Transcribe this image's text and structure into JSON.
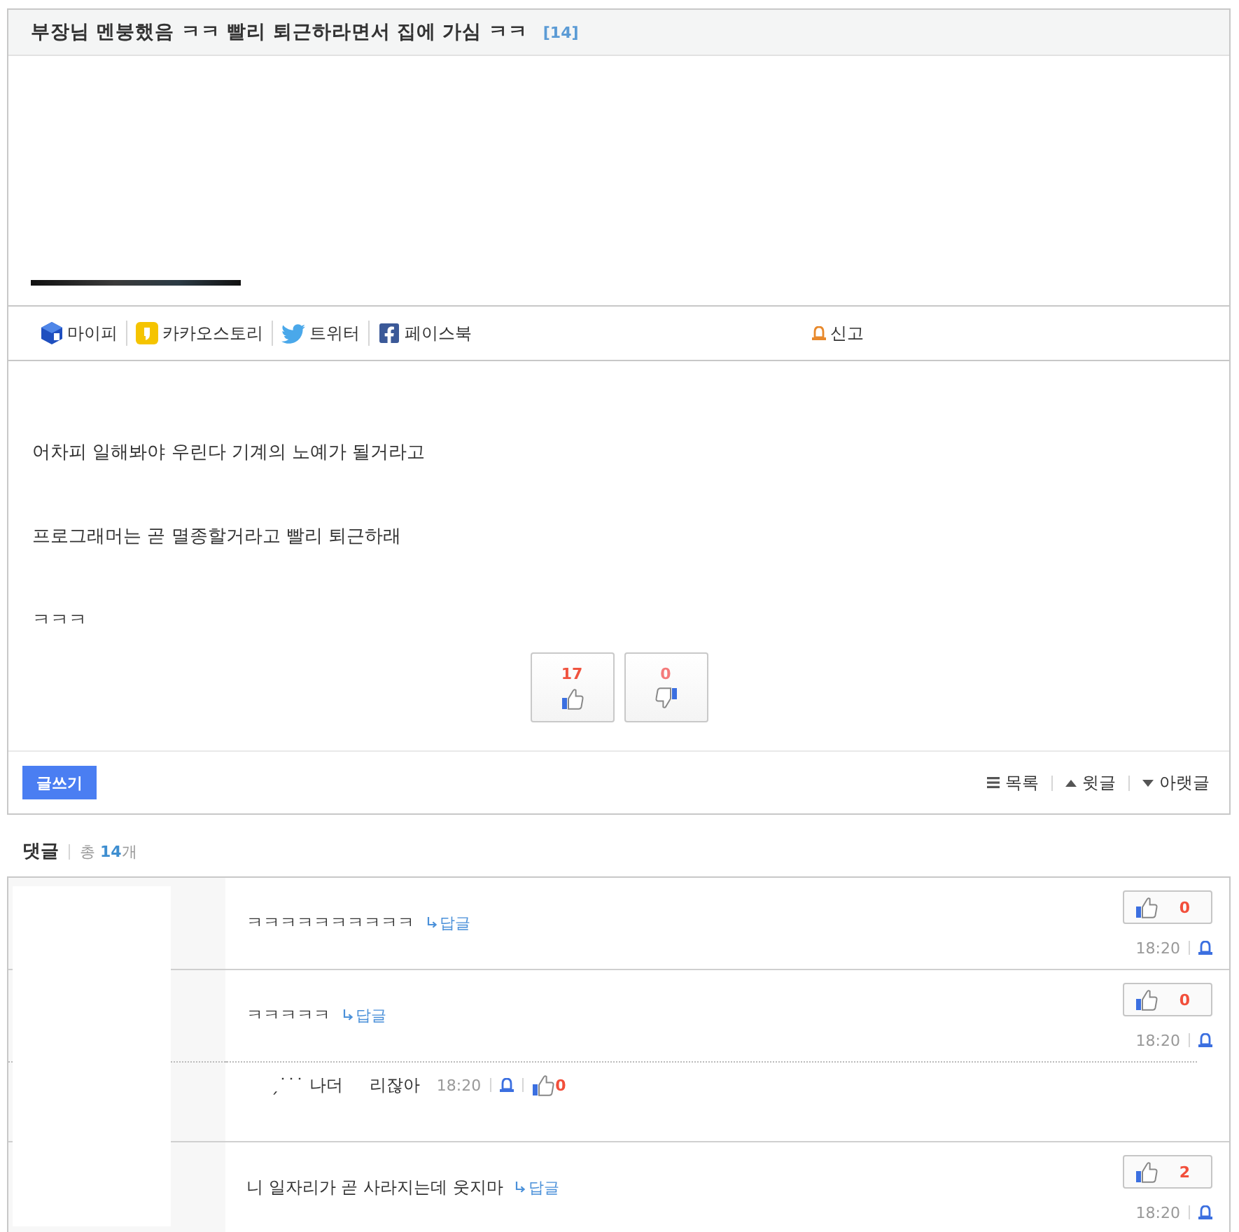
{
  "post": {
    "title": "부장님 멘붕했음 ㅋㅋ 빨리 퇴근하라면서 집에 가심 ㅋㅋ",
    "comment_count": "[14]"
  },
  "share": {
    "items": [
      {
        "kind": "mypeople",
        "label": "마이피"
      },
      {
        "kind": "kakaostory",
        "label": "카카오스토리"
      },
      {
        "kind": "twitter",
        "label": "트위터"
      },
      {
        "kind": "facebook",
        "label": "페이스북"
      }
    ],
    "report": "신고"
  },
  "body": {
    "paragraphs": [
      "어차피 일해봐야 우린다 기계의 노예가 될거라고",
      "프로그래머는 곧 멸종할거라고 빨리 퇴근하래",
      "ㅋㅋㅋ"
    ]
  },
  "votes": [
    {
      "kind": "up",
      "count": "17"
    },
    {
      "kind": "down",
      "count": "0"
    }
  ],
  "footer": {
    "write_button": "글쓰기",
    "nav": [
      {
        "kind": "list",
        "label": "목록"
      },
      {
        "kind": "prev",
        "label": "윗글"
      },
      {
        "kind": "next",
        "label": "아랫글"
      }
    ]
  },
  "comments_header": {
    "title": "댓글",
    "total": "총 **14**개"
  },
  "comments": [
    {
      "text": "ㅋㅋㅋㅋㅋㅋㅋㅋㅋㅋ",
      "reply_link": "답글",
      "likes": "0",
      "time": "18:20"
    },
    {
      "text": "ㅋㅋㅋㅋㅋ",
      "reply_link": "답글",
      "likes": "0",
      "time": "18:20",
      "replies": [
        {
          "text": "ˏ˙˙˙ 나더     리잖아",
          "time": "18:20",
          "likes": "0"
        }
      ]
    },
    {
      "text": "니 일자리가 곧 사라지는데 웃지마",
      "reply_link": "답글",
      "likes": "2",
      "time": "18:20"
    }
  ]
}
